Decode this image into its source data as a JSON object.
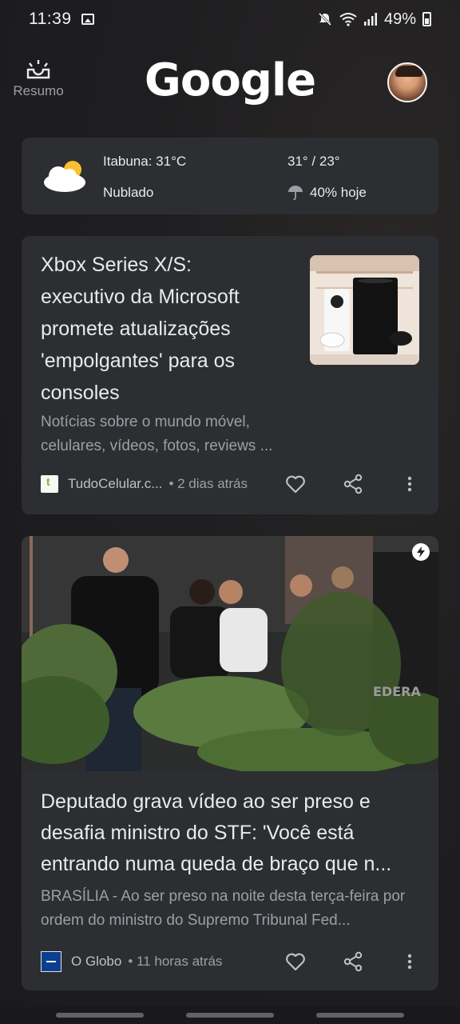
{
  "status_bar": {
    "time": "11:39",
    "battery": "49%",
    "icons": [
      "image-icon",
      "mute-icon",
      "wifi-icon",
      "signal-icon",
      "battery-icon"
    ]
  },
  "header": {
    "resumo_label": "Resumo",
    "logo": "Google",
    "avatar": "avatar"
  },
  "weather": {
    "location_temp": "Itabuna: 31°C",
    "condition": "Nublado",
    "high_low": "31° / 23°",
    "rain": "40% hoje"
  },
  "articles": [
    {
      "title": "Xbox Series X/S: executivo da Microsoft promete atualizações 'empolgantes' para os consoles",
      "snippet": "Notícias sobre o mundo móvel, celulares, vídeos, fotos, reviews ...",
      "source": "TudoCelular.c...",
      "time": "• 2 dias atrás"
    },
    {
      "title": "Deputado grava vídeo ao ser preso e desafia ministro do STF: 'Você está entrando numa queda de braço que n...",
      "snippet": "BRASÍLIA - Ao ser preso na noite desta terça-feira por ordem do ministro do Supremo Tribunal Fed...",
      "source": "O Globo",
      "time": "• 11 horas atrás"
    }
  ],
  "colors": {
    "background": "#1f1f21",
    "card": "#2d2e31",
    "text_primary": "#e8eaed",
    "text_secondary": "#9aa0a6"
  }
}
